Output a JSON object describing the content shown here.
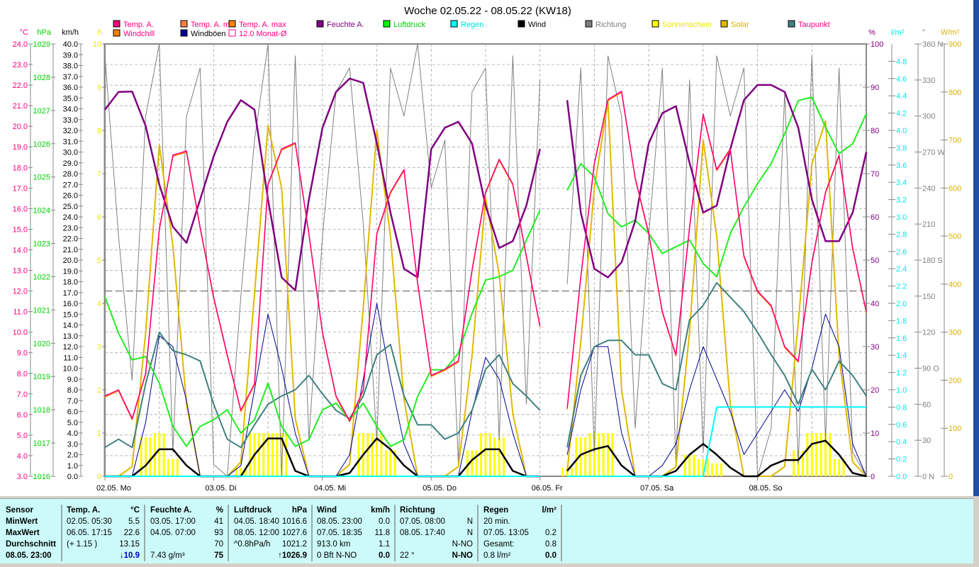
{
  "title": "Woche 02.05.22 - 08.05.22 (KW18)",
  "legend": [
    {
      "label": "Temp. A.",
      "color": "#ff0080",
      "text_color": "#ff0080"
    },
    {
      "label": "Temp. A. min",
      "color": "#ff8040",
      "text_color": "#ff0080"
    },
    {
      "label": "Temp. A. max",
      "color": "#ff8000",
      "text_color": "#ff0080"
    },
    {
      "label": "Feuchte A.",
      "color": "#800080",
      "text_color": "#800080"
    },
    {
      "label": "Luftdruck",
      "color": "#00ff00",
      "text_color": "#00d000"
    },
    {
      "label": "Regen",
      "color": "#00ffff",
      "text_color": "#00e0e0"
    },
    {
      "label": "Wind",
      "color": "#000000",
      "text_color": "#000000"
    },
    {
      "label": "Richtung",
      "color": "#808080",
      "text_color": "#808080"
    },
    {
      "label": "Sonnenschein",
      "color": "#ffff00",
      "text_color": "#e8e800"
    },
    {
      "label": "Solar",
      "color": "#e0b800",
      "text_color": "#d8b000"
    },
    {
      "label": "Taupunkt",
      "color": "#408080",
      "text_color": "#ff0080"
    },
    {
      "label": "Windchill",
      "color": "#ff8000",
      "text_color": "#ff0080"
    },
    {
      "label": "Windböen",
      "color": "#000090",
      "text_color": "#000000"
    },
    {
      "label": "12.0 Monat-Ø",
      "color": "#ff0080",
      "text_color": "#ff0080"
    }
  ],
  "chart_data": {
    "type": "line",
    "title": "Woche 02.05.22 - 08.05.22 (KW18)",
    "x_unit": "hours since 02.05. 00:00",
    "x_step_hours": 3,
    "x_ticks": [
      "02.05. Mo",
      "03.05. Di",
      "04.05. Mi",
      "05.05. Do",
      "06.05. Fr",
      "07.05. Sa",
      "08.05. So"
    ],
    "axes": {
      "temp": {
        "unit": "°C",
        "range": [
          3,
          24
        ],
        "color": "#ff0080"
      },
      "pressure": {
        "unit": "hPa",
        "range": [
          1016,
          1029
        ],
        "color": "#00d000"
      },
      "wind": {
        "unit": "km/h",
        "range": [
          0,
          40
        ],
        "color": "#000000"
      },
      "sun": {
        "unit": "h",
        "range": [
          0,
          10
        ],
        "color": "#e8e800"
      },
      "humidity": {
        "unit": "%",
        "range": [
          0,
          100
        ],
        "color": "#800080"
      },
      "rain": {
        "unit": "l/m²",
        "range": [
          0,
          5
        ],
        "ticks_max": 4.8,
        "color": "#00e8e8"
      },
      "direction": {
        "unit": "°",
        "range": [
          0,
          360
        ],
        "color": "#808080",
        "labels": {
          "0": "0    N",
          "90": "90  O",
          "180": "180 S",
          "270": "270 W",
          "360": "360 N"
        }
      },
      "solar": {
        "unit": "W/m²",
        "range": [
          0,
          900
        ],
        "color": "#d8b000"
      }
    },
    "monthly_avg_temp": 12.0,
    "series": {
      "solar": [
        0,
        0,
        20,
        300,
        690,
        480,
        150,
        0,
        0,
        0,
        30,
        380,
        730,
        600,
        120,
        0,
        0,
        0,
        25,
        350,
        720,
        500,
        160,
        0,
        0,
        0,
        20,
        250,
        580,
        420,
        130,
        0,
        0,
        null,
        10,
        280,
        600,
        780,
        180,
        0,
        0,
        0,
        20,
        300,
        700,
        500,
        150,
        0,
        0,
        0,
        20,
        320,
        650,
        740,
        250,
        30,
        0
      ],
      "sunshine": [
        0,
        0,
        0,
        0.9,
        1,
        0.4,
        0,
        0,
        0,
        0,
        0.2,
        1,
        1,
        1,
        0,
        0,
        0,
        0,
        0,
        1,
        1,
        0.6,
        0,
        0,
        0,
        0,
        0,
        0.6,
        1,
        0.9,
        0,
        0,
        0,
        null,
        0.2,
        0.9,
        1,
        1,
        0,
        0,
        0,
        0,
        0,
        0.5,
        0.4,
        0.3,
        0,
        0,
        0,
        0,
        0,
        0.6,
        1,
        1,
        0.4,
        0,
        0
      ],
      "direction": [
        350,
        200,
        80,
        300,
        360,
        20,
        300,
        340,
        10,
        0,
        150,
        280,
        360,
        0,
        350,
        30,
        200,
        320,
        340,
        210,
        30,
        340,
        300,
        360,
        240,
        280,
        10,
        320,
        340,
        30,
        350,
        60,
        330,
        null,
        160,
        340,
        20,
        350,
        300,
        40,
        200,
        340,
        10,
        330,
        20,
        350,
        300,
        340,
        0,
        40,
        320,
        10,
        350,
        30,
        340,
        20,
        0
      ],
      "rain": [
        0,
        0,
        0,
        0,
        0,
        0,
        0,
        0,
        0,
        0,
        0,
        0,
        0,
        0,
        0,
        0,
        0,
        0,
        0,
        0,
        0,
        0,
        0,
        0,
        0,
        0,
        0,
        0,
        0,
        0,
        0,
        0,
        0,
        null,
        0,
        0,
        0,
        0,
        0,
        0,
        0,
        0,
        0,
        0,
        0,
        0.8,
        0.8,
        0.8,
        0.8,
        0.8,
        0.8,
        0.8,
        0.8,
        0.8,
        0.8,
        0.8,
        0.8
      ],
      "gusts": [
        0,
        0,
        0,
        5,
        13,
        12,
        7,
        0,
        0,
        0,
        1,
        8,
        15,
        10,
        4,
        0,
        0,
        0,
        2,
        9,
        16,
        9,
        3,
        0,
        0,
        0,
        0,
        6,
        11,
        9,
        4,
        0,
        0,
        null,
        2,
        8,
        12,
        12,
        4,
        0,
        0,
        1,
        3,
        8,
        12,
        9,
        6,
        2,
        4,
        6,
        8,
        6,
        10,
        15,
        12,
        3,
        0
      ],
      "wind": [
        0,
        0,
        0,
        1,
        2.5,
        2.5,
        1,
        0,
        0,
        0,
        0,
        2,
        3.5,
        3.5,
        0.5,
        0,
        0,
        0,
        0.3,
        2,
        3.5,
        2.5,
        1,
        0,
        0,
        0,
        0,
        1.5,
        2.5,
        2.5,
        0.5,
        0,
        0,
        null,
        0.5,
        2,
        2.5,
        2.8,
        1,
        0,
        0,
        0,
        0.5,
        2,
        3,
        2,
        0.8,
        0,
        0,
        1,
        1.5,
        1.5,
        3,
        3.3,
        2,
        0.3,
        0
      ],
      "dewpoint": [
        4.4,
        4.8,
        4.4,
        7.5,
        10,
        9.1,
        8.9,
        8.6,
        6.5,
        4.8,
        4.4,
        5.5,
        6.5,
        6.9,
        7.2,
        7.9,
        7,
        6.2,
        5.8,
        6.9,
        8.9,
        9.4,
        6.9,
        5.5,
        5.5,
        4.8,
        5.1,
        6.2,
        8.2,
        8.9,
        7.5,
        6.9,
        6.2,
        null,
        4.4,
        7.9,
        9.3,
        9.6,
        9.6,
        8.9,
        8.9,
        7.5,
        7.2,
        10.6,
        11.3,
        12.4,
        11.7,
        11,
        10,
        8.9,
        7.9,
        6.5,
        8.2,
        7.2,
        8.6,
        7.9,
        6.9
      ],
      "pressure": [
        1021.4,
        1020.3,
        1019.5,
        1019.6,
        1018.8,
        1017.5,
        1016.9,
        1017.5,
        1017.7,
        1018,
        1017.3,
        1017.7,
        1018.8,
        1017.5,
        1016.9,
        1017.1,
        1018,
        1018.2,
        1017.7,
        1018.2,
        1017.5,
        1016.9,
        1017.1,
        1018.4,
        1019.2,
        1019.2,
        1019.7,
        1020.9,
        1021.9,
        1022,
        1022.2,
        1023.1,
        1024,
        null,
        1024.6,
        1025.4,
        1025,
        1023.9,
        1023.5,
        1023.7,
        1023.3,
        1022.7,
        1022.9,
        1023.1,
        1022.4,
        1022,
        1023.3,
        1024.1,
        1024.8,
        1025.4,
        1026.3,
        1027.3,
        1027.4,
        1026.5,
        1025.7,
        1026,
        1026.9
      ],
      "humidity": [
        84.8,
        88.9,
        89,
        81,
        67.5,
        57.7,
        54,
        64,
        74,
        82,
        87,
        84.8,
        64,
        46,
        43,
        64,
        80.6,
        88.9,
        92,
        91,
        77,
        61,
        48,
        46,
        75.7,
        80.6,
        82,
        77,
        62.6,
        52.8,
        54.4,
        62.6,
        75.7,
        null,
        87,
        61,
        48,
        46,
        49.5,
        59,
        77,
        84,
        85.6,
        72.5,
        61,
        62.6,
        75.7,
        87,
        90.5,
        90.5,
        88.9,
        80.6,
        64,
        54.4,
        54.4,
        61,
        75
      ],
      "temp": [
        6.9,
        7.2,
        5.8,
        8,
        15,
        18.6,
        18.8,
        15.1,
        11.7,
        8.9,
        6.2,
        7.5,
        17.2,
        18.9,
        19.2,
        14.8,
        10,
        6.9,
        5.7,
        7.2,
        14.8,
        16.8,
        17.9,
        12.4,
        7.9,
        8.2,
        8.6,
        13,
        16.8,
        18.4,
        17.2,
        13.7,
        10.3,
        null,
        6.3,
        12.7,
        18.2,
        21.3,
        21.7,
        17.5,
        14.8,
        11,
        8.9,
        15.1,
        20.6,
        17.9,
        18.9,
        13.7,
        12,
        11.3,
        9.3,
        8.6,
        13.4,
        16.8,
        18.6,
        14.1,
        11
      ]
    }
  },
  "table": {
    "sensor": {
      "header": "Sensor",
      "rows": [
        "MinWert",
        "MaxWert",
        "Durchschnitt",
        "08.05. 23:00"
      ]
    },
    "columns": [
      {
        "header": "Temp. A.",
        "unit": "°C",
        "rows": [
          [
            "02.05.  05:30",
            "5.5"
          ],
          [
            "06.05.  17:15",
            "22.6"
          ],
          [
            "(+ 1.15 )",
            "13.15"
          ],
          [
            "",
            "↓10.9"
          ]
        ]
      },
      {
        "header": "Feuchte A.",
        "unit": "%",
        "rows": [
          [
            "03.05.  17:00",
            "41"
          ],
          [
            "04.05.  07:00",
            "93"
          ],
          [
            "",
            "70"
          ],
          [
            "7.43 g/m³",
            "75"
          ]
        ]
      },
      {
        "header": "Luftdruck",
        "unit": "hPa",
        "rows": [
          [
            "04.05.  18:40",
            "1016.6"
          ],
          [
            "08.05.  12:00",
            "1027.6"
          ],
          [
            "^0.8hPa/h",
            "1021.2"
          ],
          [
            "",
            "↑1026.9"
          ]
        ]
      },
      {
        "header": "Wind",
        "unit": "km/h",
        "rows": [
          [
            "08.05.  23:00",
            "0.0"
          ],
          [
            "07.05.  18:35",
            "11.8"
          ],
          [
            "913.0 km",
            "1.1"
          ],
          [
            "0 Bft N-NO",
            "0.0"
          ]
        ]
      },
      {
        "header": "Richtung",
        "unit": "",
        "rows": [
          [
            "07.05.  08:00",
            "N"
          ],
          [
            "08.05.  17:40",
            "N"
          ],
          [
            "",
            "N-NO"
          ],
          [
            "22 °",
            "N-NO"
          ]
        ]
      },
      {
        "header": "Regen",
        "unit": "l/m²",
        "rows": [
          [
            "20 min.",
            ""
          ],
          [
            "07.05.  13:05",
            "0.2"
          ],
          [
            "Gesamt:",
            "0.8"
          ],
          [
            "0.8 l/m²",
            "0.0"
          ]
        ]
      }
    ]
  }
}
